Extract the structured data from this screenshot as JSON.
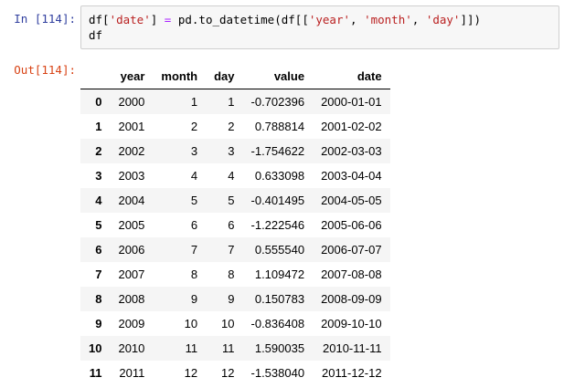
{
  "notebook": {
    "input_prompt": "In [114]:",
    "output_prompt": "Out[114]:",
    "code_lines": [
      [
        {
          "text": "df[",
          "type": "plain"
        },
        {
          "text": "'date'",
          "type": "string"
        },
        {
          "text": "] ",
          "type": "plain"
        },
        {
          "text": "=",
          "type": "operator"
        },
        {
          "text": " pd.to_datetime(df[[",
          "type": "plain"
        },
        {
          "text": "'year'",
          "type": "string"
        },
        {
          "text": ", ",
          "type": "plain"
        },
        {
          "text": "'month'",
          "type": "string"
        },
        {
          "text": ", ",
          "type": "plain"
        },
        {
          "text": "'day'",
          "type": "string"
        },
        {
          "text": "]])",
          "type": "plain"
        }
      ],
      [
        {
          "text": "df",
          "type": "plain"
        }
      ]
    ]
  },
  "colors": {
    "input_prompt": "#303F9F",
    "output_prompt": "#D84315",
    "code_string": "#BA2121",
    "code_operator": "#AA22FF",
    "code_background": "#F7F7F7",
    "code_border": "#CFCFCF",
    "table_row_stripe": "#F5F5F5"
  },
  "table": {
    "index_header": "",
    "columns": [
      "year",
      "month",
      "day",
      "value",
      "date"
    ],
    "rows": [
      {
        "index": "0",
        "cells": [
          "2000",
          "1",
          "1",
          "-0.702396",
          "2000-01-01"
        ]
      },
      {
        "index": "1",
        "cells": [
          "2001",
          "2",
          "2",
          "0.788814",
          "2001-02-02"
        ]
      },
      {
        "index": "2",
        "cells": [
          "2002",
          "3",
          "3",
          "-1.754622",
          "2002-03-03"
        ]
      },
      {
        "index": "3",
        "cells": [
          "2003",
          "4",
          "4",
          "0.633098",
          "2003-04-04"
        ]
      },
      {
        "index": "4",
        "cells": [
          "2004",
          "5",
          "5",
          "-0.401495",
          "2004-05-05"
        ]
      },
      {
        "index": "5",
        "cells": [
          "2005",
          "6",
          "6",
          "-1.222546",
          "2005-06-06"
        ]
      },
      {
        "index": "6",
        "cells": [
          "2006",
          "7",
          "7",
          "0.555540",
          "2006-07-07"
        ]
      },
      {
        "index": "7",
        "cells": [
          "2007",
          "8",
          "8",
          "1.109472",
          "2007-08-08"
        ]
      },
      {
        "index": "8",
        "cells": [
          "2008",
          "9",
          "9",
          "0.150783",
          "2008-09-09"
        ]
      },
      {
        "index": "9",
        "cells": [
          "2009",
          "10",
          "10",
          "-0.836408",
          "2009-10-10"
        ]
      },
      {
        "index": "10",
        "cells": [
          "2010",
          "11",
          "11",
          "1.590035",
          "2010-11-11"
        ]
      },
      {
        "index": "11",
        "cells": [
          "2011",
          "12",
          "12",
          "-1.538040",
          "2011-12-12"
        ]
      }
    ]
  }
}
